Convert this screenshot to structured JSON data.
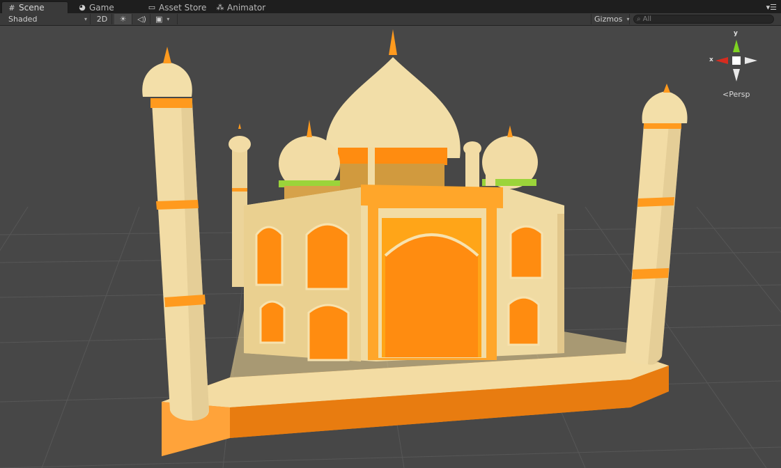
{
  "window": {
    "tabs": [
      {
        "label": "Scene",
        "icon": "scene-grid-icon",
        "active": true
      },
      {
        "label": "Game",
        "icon": "game-pacman-icon",
        "active": false
      },
      {
        "label": "Asset Store",
        "icon": "asset-store-icon",
        "active": false
      },
      {
        "label": "Animator",
        "icon": "animator-icon",
        "active": false
      }
    ],
    "tab_menu_icon": "tab-menu-icon"
  },
  "toolbar": {
    "draw_mode": "Shaded",
    "mode_2d": "2D",
    "lighting_icon": "sun-icon",
    "audio_icon": "audio-speaker-icon",
    "effects_icon": "image-effects-icon",
    "gizmos_label": "Gizmos",
    "search_placeholder": "All",
    "search_icon": "search-icon"
  },
  "scene_gizmo": {
    "axis_x": "x",
    "axis_y": "y",
    "projection_label": "Persp",
    "colors": {
      "x": "#d62c1f",
      "y": "#7ed321",
      "z": "#e8e8e8"
    }
  },
  "viewport": {
    "background": "#474747",
    "grid_color": "#5a5a5a",
    "model_colors": {
      "cream": "#f1dea6",
      "cream_shadow": "#d8c08a",
      "orange": "#ff8c10",
      "orange_dark": "#e0740c",
      "green_trim": "#9bd43a"
    }
  }
}
